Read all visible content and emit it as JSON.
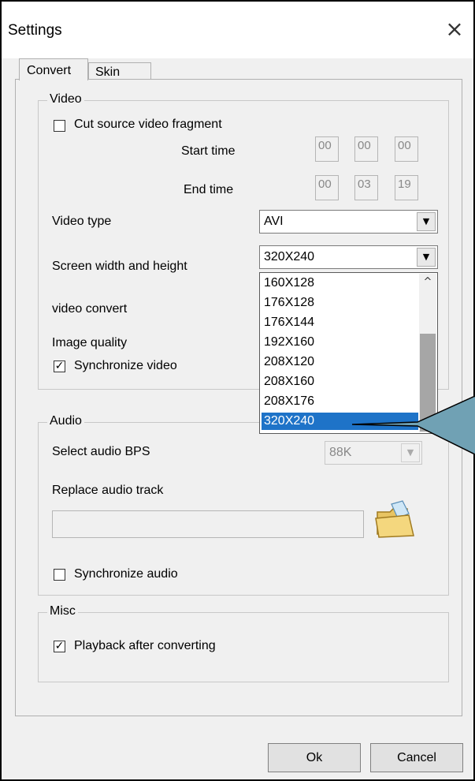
{
  "window": {
    "title": "Settings",
    "close_glyph": "×"
  },
  "tabs": [
    {
      "label": "Convert",
      "active": true
    },
    {
      "label": "Skin",
      "active": false
    }
  ],
  "video": {
    "legend": "Video",
    "cut_label": "Cut source video fragment",
    "cut_checked": false,
    "start_label": "Start time",
    "start": [
      "00",
      "00",
      "00"
    ],
    "end_label": "End time",
    "end": [
      "00",
      "03",
      "19"
    ],
    "type_label": "Video type",
    "type_value": "AVI",
    "size_label": "Screen width and height",
    "size_value": "320X240",
    "convert_label": "video convert",
    "quality_label": "Image quality",
    "sync_label": "Synchronize video",
    "sync_checked": true
  },
  "dropdown": {
    "options": [
      "160X128",
      "176X128",
      "176X144",
      "192X160",
      "208X120",
      "208X160",
      "208X176",
      "320X240"
    ],
    "selected": "320X240"
  },
  "audio": {
    "legend": "Audio",
    "bps_label": "Select audio BPS",
    "bps_value": "88K",
    "replace_label": "Replace audio track",
    "track_value": "",
    "sync_label": "Synchronize audio",
    "sync_checked": false
  },
  "misc": {
    "legend": "Misc",
    "playback_label": "Playback after converting",
    "playback_checked": true
  },
  "buttons": {
    "ok": "Ok",
    "cancel": "Cancel"
  },
  "colors": {
    "selection": "#1e73c8",
    "callout": "#70a1b4"
  },
  "icons": {
    "close": "close-icon",
    "folder": "open-folder-icon",
    "dropdown_arrow": "chevron-down-icon"
  }
}
